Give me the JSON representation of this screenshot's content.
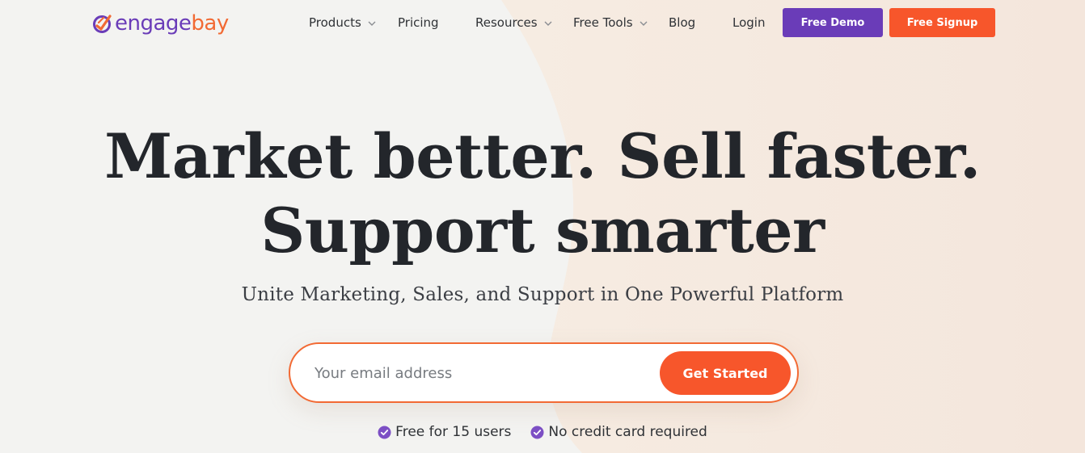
{
  "brand": {
    "logo_part1": "engage",
    "logo_part2": "bay",
    "colors": {
      "purple": "#6a3cb8",
      "orange": "#f7562b",
      "text": "#23262b"
    }
  },
  "nav": {
    "items": [
      {
        "label": "Products",
        "has_dropdown": true,
        "icon": "chevron-down-icon"
      },
      {
        "label": "Pricing",
        "has_dropdown": false
      },
      {
        "label": "Resources",
        "has_dropdown": true,
        "icon": "chevron-down-icon"
      },
      {
        "label": "Free Tools",
        "has_dropdown": true,
        "icon": "chevron-down-icon"
      },
      {
        "label": "Blog",
        "has_dropdown": false
      },
      {
        "label": "Login",
        "has_dropdown": false
      }
    ],
    "demo_button": "Free Demo",
    "signup_button": "Free Signup"
  },
  "hero": {
    "title_line1": "Market better. Sell faster.",
    "title_line2": "Support smarter",
    "subtitle": "Unite Marketing, Sales, and Support in One Powerful Platform"
  },
  "signup_form": {
    "email_placeholder": "Your email address",
    "email_value": "",
    "cta_label": "Get Started"
  },
  "features": [
    {
      "label": "Free for 15 users",
      "icon": "check-circle-icon"
    },
    {
      "label": "No credit card required",
      "icon": "check-circle-icon"
    }
  ]
}
